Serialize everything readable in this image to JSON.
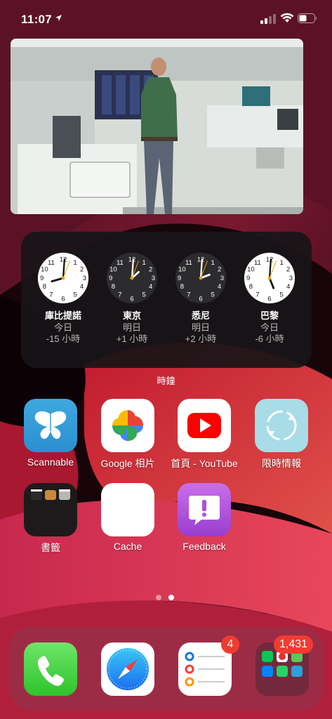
{
  "status_bar": {
    "time": "11:07"
  },
  "widget": {
    "label": "時鐘",
    "clocks": [
      {
        "city": "庫比提諾",
        "day": "今日",
        "offset": "-15 小時",
        "face": "light"
      },
      {
        "city": "東京",
        "day": "明日",
        "offset": "+1 小時",
        "face": "dark"
      },
      {
        "city": "悉尼",
        "day": "明日",
        "offset": "+2 小時",
        "face": "dark"
      },
      {
        "city": "巴黎",
        "day": "今日",
        "offset": "-6 小時",
        "face": "light"
      }
    ]
  },
  "apps": {
    "scannable": "Scannable",
    "google_photos": "Google 相片",
    "youtube": "首頁 - YouTube",
    "limited": "限時情報",
    "bookmarks": "書籤",
    "cache": "Cache",
    "feedback": "Feedback"
  },
  "dock": {
    "reminders_badge": "4",
    "folder_badge": "1,431"
  },
  "colors": {
    "accent_red": "#f23b30",
    "widget_bg": "#181418"
  }
}
